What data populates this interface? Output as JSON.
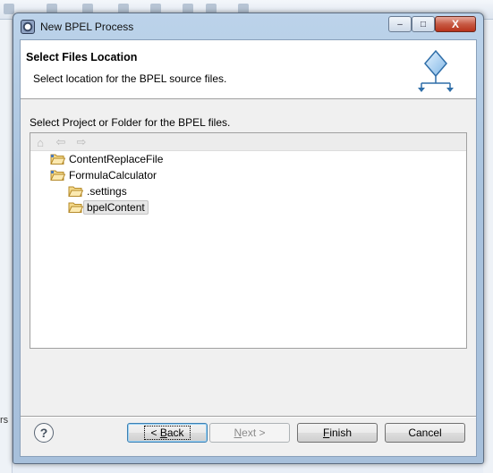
{
  "window": {
    "title": "New BPEL Process",
    "controls": {
      "minimize": "–",
      "maximize": "□",
      "close": "X"
    }
  },
  "banner": {
    "title": "Select Files Location",
    "description": "Select location for the BPEL source files.",
    "icon": "bpel-process-icon"
  },
  "prompt": "Select Project or Folder for the BPEL files.",
  "tree_toolbar": [
    {
      "name": "home-icon",
      "glyph": "⌂"
    },
    {
      "name": "back-arrow-icon",
      "glyph": "⇦"
    },
    {
      "name": "forward-arrow-icon",
      "glyph": "⇨"
    }
  ],
  "tree": [
    {
      "label": "ContentReplaceFile",
      "level": 0,
      "icon": "project-folder-icon",
      "selected": false
    },
    {
      "label": "FormulaCalculator",
      "level": 0,
      "icon": "project-folder-icon",
      "selected": false
    },
    {
      "label": ".settings",
      "level": 1,
      "icon": "folder-icon",
      "selected": false
    },
    {
      "label": "bpelContent",
      "level": 1,
      "icon": "folder-icon",
      "selected": true
    }
  ],
  "buttons": {
    "help": "?",
    "back": {
      "prefix": "< ",
      "mnemonic": "B",
      "rest": "ack"
    },
    "next": {
      "mnemonic": "N",
      "rest": "ext >"
    },
    "finish": {
      "mnemonic": "F",
      "rest": "inish"
    },
    "cancel": "Cancel"
  },
  "background": {
    "left_label": "rs"
  },
  "colors": {
    "title_gradient": "#a9c3de",
    "close_button": "#c75a44",
    "default_button_border": "#3c7fb1",
    "folder": "#e8c25a"
  }
}
